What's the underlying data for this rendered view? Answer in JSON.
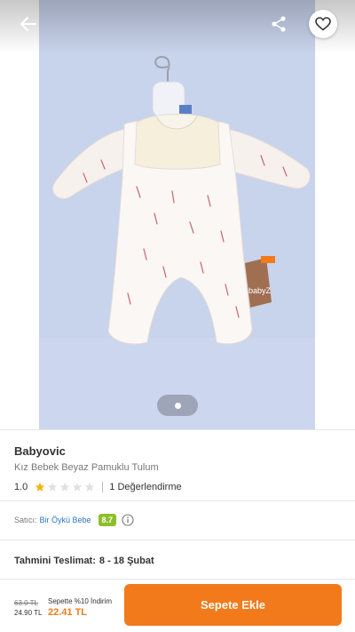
{
  "hero": {
    "image_alt": "Kız Bebek Beyaz Pamuklu Tulum",
    "tag_text": "babyZ",
    "icons": {
      "back": "arrow-left-icon",
      "share": "share-icon",
      "favorite": "heart-outline-icon"
    },
    "pager_count": 1
  },
  "product": {
    "brand": "Babyovic",
    "name": "Kız Bebek Beyaz Pamuklu Tulum",
    "rating": "1.0",
    "rating_stars": 1,
    "rating_max": 5,
    "reviews": "1 Değerlendirme"
  },
  "seller": {
    "label": "Satıcı:",
    "name": "Bir Öykü Bebe",
    "score": "8.7",
    "info_icon": "info-icon"
  },
  "delivery": {
    "label": "Tahmini Teslimat:",
    "range": "8 - 18 Şubat"
  },
  "bottom": {
    "old_price": "63.0 TL",
    "price": "24.90 TL",
    "promo_text": "Sepette %10 İndirim",
    "promo_price": "22.41 TL",
    "cart_label": "Sepete Ekle"
  },
  "colors": {
    "accent": "#f27a1a",
    "seller_link": "#2b74c4",
    "score_badge": "#8cbf2c",
    "star_filled": "#f5b400",
    "star_empty": "#e0e0e0"
  }
}
